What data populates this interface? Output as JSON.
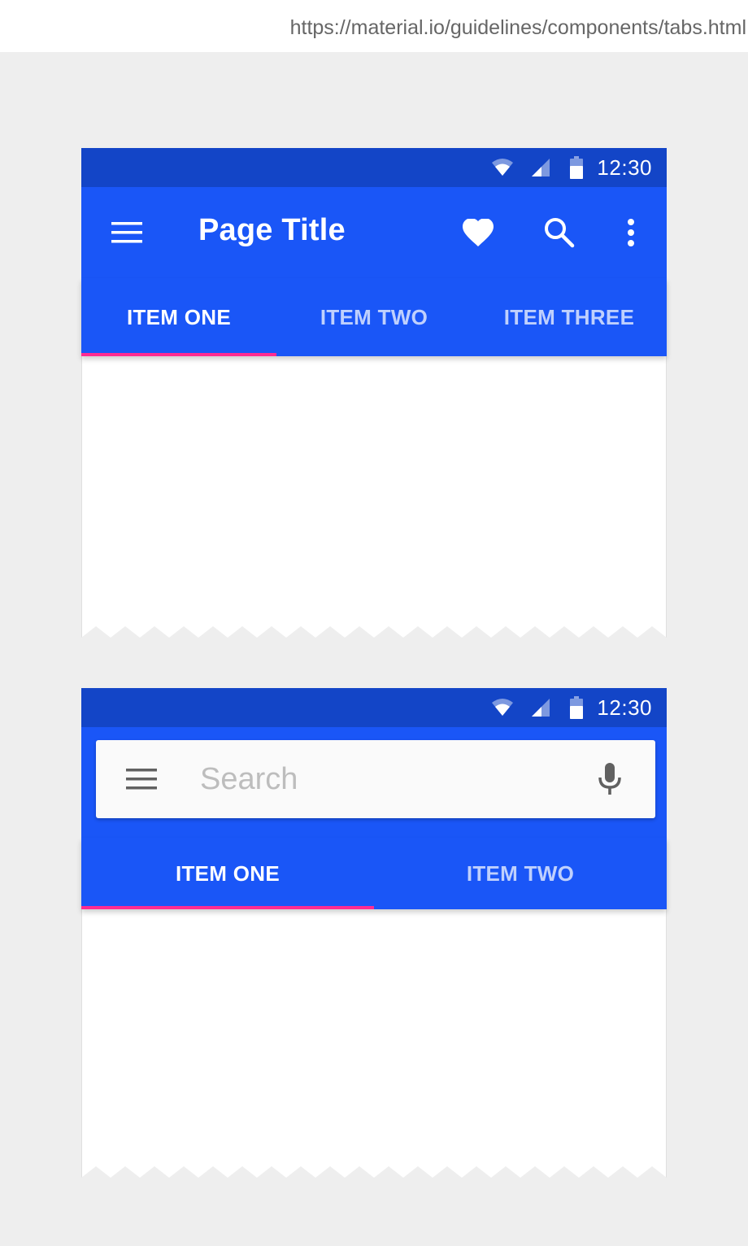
{
  "browser": {
    "url": "https://material.io/guidelines/components/tabs.html"
  },
  "colors": {
    "status_bar": "#1345c7",
    "primary": "#1a56f7",
    "indicator": "#ff2b92",
    "background": "#eeeeee"
  },
  "example1": {
    "status": {
      "time": "12:30",
      "icons": [
        "wifi-icon",
        "signal-icon",
        "battery-icon"
      ]
    },
    "app_bar": {
      "title": "Page Title",
      "nav_icon": "menu-icon",
      "actions": [
        "heart-icon",
        "search-icon",
        "more-vert-icon"
      ]
    },
    "tabs": [
      {
        "label": "ITEM ONE",
        "selected": true
      },
      {
        "label": "ITEM TWO",
        "selected": false
      },
      {
        "label": "ITEM THREE",
        "selected": false
      }
    ]
  },
  "example2": {
    "status": {
      "time": "12:30",
      "icons": [
        "wifi-icon",
        "signal-icon",
        "battery-icon"
      ]
    },
    "search": {
      "placeholder": "Search",
      "value": "",
      "nav_icon": "menu-icon",
      "action_icon": "mic-icon"
    },
    "tabs": [
      {
        "label": "ITEM ONE",
        "selected": true
      },
      {
        "label": "ITEM TWO",
        "selected": false
      }
    ]
  }
}
